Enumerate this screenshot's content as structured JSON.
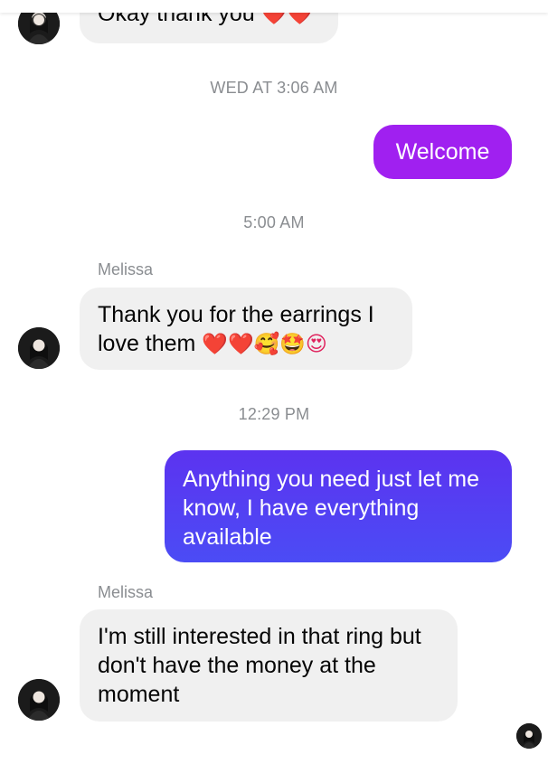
{
  "conversation": {
    "messages": [
      {
        "type": "incoming",
        "text": "Okay thank you",
        "emoji": "❤️❤️"
      },
      {
        "type": "timestamp",
        "text": "WED AT 3:06 AM"
      },
      {
        "type": "outgoing",
        "text": "Welcome"
      },
      {
        "type": "timestamp",
        "text": "5:00 AM"
      },
      {
        "type": "sender",
        "text": "Melissa"
      },
      {
        "type": "incoming",
        "text": "Thank you for the earrings I love them",
        "emoji": "❤️❤️🥰🤩😍"
      },
      {
        "type": "timestamp",
        "text": "12:29 PM"
      },
      {
        "type": "outgoing",
        "text": "Anything you need just let me know, I have everything available"
      },
      {
        "type": "sender",
        "text": "Melissa"
      },
      {
        "type": "incoming",
        "text": "I'm still interested in that ring but don't have the money at the moment"
      }
    ]
  },
  "colors": {
    "incoming_bubble": "#f0f0f0",
    "outgoing_purple": "#a020f0",
    "outgoing_blue_top": "#5c33f0",
    "outgoing_blue_bottom": "#4b4cf5",
    "timestamp_text": "#8a8d91"
  },
  "icons": {
    "contact_avatar": "avatar-icon",
    "read_receipt": "seen-avatar-icon"
  }
}
